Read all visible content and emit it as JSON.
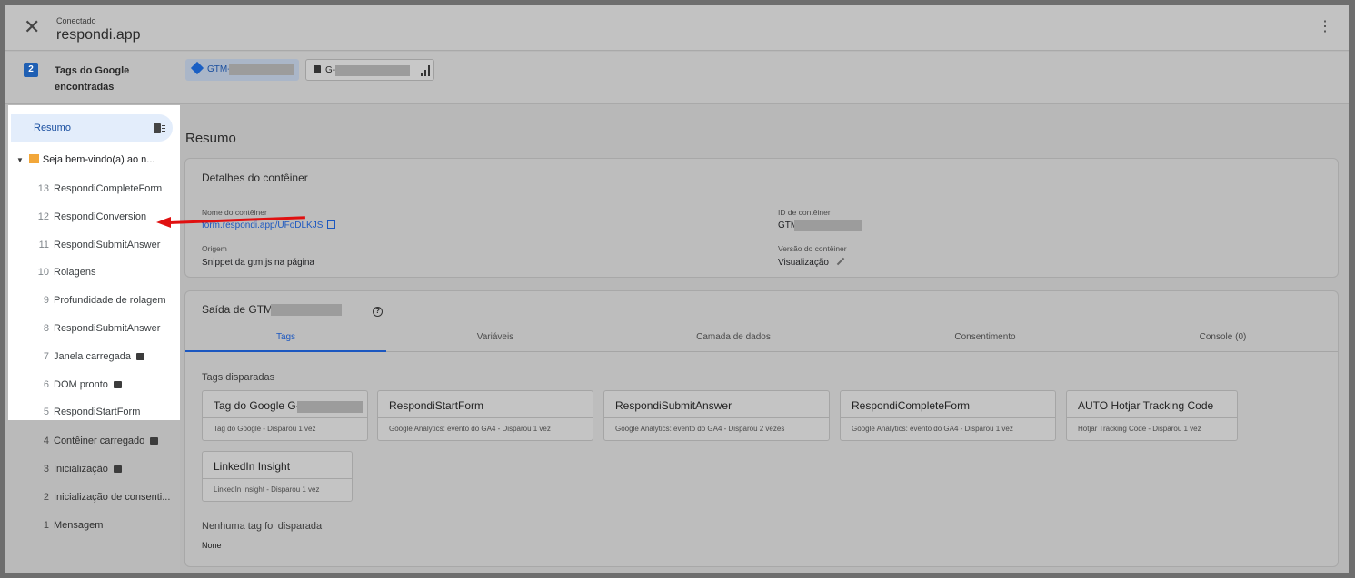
{
  "header": {
    "status": "Conectado",
    "title": "respondi.app",
    "close_glyph": "✕",
    "menu_glyph": "⋮"
  },
  "tags_row": {
    "count": "2",
    "label": "Tags do Google encontradas",
    "gtm_chip": "GTM-\\",
    "ga_chip": "G-"
  },
  "sidebar": {
    "summary": "Resumo",
    "group": "Seja bem-vindo(a) ao n...",
    "events": [
      {
        "num": "13",
        "label": "RespondiCompleteForm"
      },
      {
        "num": "12",
        "label": "RespondiConversion"
      },
      {
        "num": "11",
        "label": "RespondiSubmitAnswer"
      },
      {
        "num": "10",
        "label": "Rolagens"
      },
      {
        "num": "9",
        "label": "Profundidade de rolagem"
      },
      {
        "num": "8",
        "label": "RespondiSubmitAnswer"
      },
      {
        "num": "7",
        "label": "Janela carregada"
      },
      {
        "num": "6",
        "label": "DOM pronto"
      },
      {
        "num": "5",
        "label": "RespondiStartForm"
      },
      {
        "num": "4",
        "label": "Contêiner carregado"
      },
      {
        "num": "3",
        "label": "Inicialização"
      },
      {
        "num": "2",
        "label": "Inicialização de consenti..."
      },
      {
        "num": "1",
        "label": "Mensagem"
      }
    ]
  },
  "main": {
    "title": "Resumo",
    "details": {
      "title": "Detalhes do contêiner",
      "name_label": "Nome do contêiner",
      "name_value": "form.respondi.app/UFoDLKJS",
      "id_label": "ID de contêiner",
      "id_value": "GTM-\\",
      "origin_label": "Origem",
      "origin_value": "Snippet da gtm.js na página",
      "version_label": "Versão do contêiner",
      "version_value": "Visualização"
    },
    "output": {
      "title": "Saída de GTM-",
      "help_glyph": "?",
      "tabs": [
        "Tags",
        "Variáveis",
        "Camada de dados",
        "Consentimento",
        "Console (0)"
      ],
      "fired_label": "Tags disparadas",
      "fired_tags": [
        {
          "title": "Tag do Google G-",
          "sub": "Tag do Google - Disparou 1 vez"
        },
        {
          "title": "RespondiStartForm",
          "sub": "Google Analytics: evento do GA4 - Disparou 1 vez"
        },
        {
          "title": "RespondiSubmitAnswer",
          "sub": "Google Analytics: evento do GA4 - Disparou 2 vezes"
        },
        {
          "title": "RespondiCompleteForm",
          "sub": "Google Analytics: evento do GA4 - Disparou 1 vez"
        },
        {
          "title": "AUTO Hotjar Tracking Code",
          "sub": "Hotjar Tracking Code - Disparou 1 vez"
        },
        {
          "title": "LinkedIn Insight",
          "sub": "LinkedIn Insight - Disparou 1 vez"
        }
      ],
      "not_fired_label": "Nenhuma tag foi disparada",
      "not_fired_value": "None"
    }
  },
  "colors": {
    "accent": "#1b57c0",
    "arrow": "#e01010",
    "group_square": "#f2a73a"
  }
}
